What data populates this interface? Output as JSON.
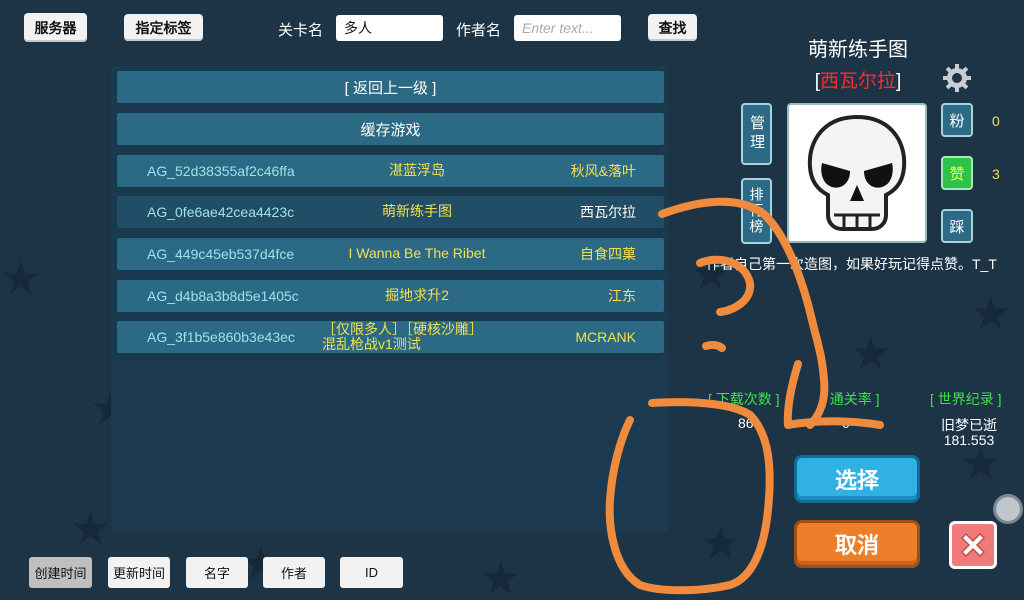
{
  "top_bar": {
    "server_label": "服务器",
    "tag_label": "指定标签",
    "level_name_label": "关卡名",
    "level_name_value": "多人",
    "author_label": "作者名",
    "author_placeholder": "Enter text...",
    "search_label": "查找"
  },
  "list": {
    "back_label": "[ 返回上一级 ]",
    "cache_label": "缓存游戏",
    "rows": [
      {
        "id": "AG_52d38355af2c46ffa",
        "name": "湛蓝浮岛",
        "author": "秋风&落叶"
      },
      {
        "id": "AG_0fe6ae42cea4423c",
        "name": "萌新练手图",
        "author": "西瓦尔拉"
      },
      {
        "id": "AG_449c45eb537d4fce",
        "name": "I Wanna Be The Ribet",
        "author": "自食四菓"
      },
      {
        "id": "AG_d4b8a3b8d5e1405c",
        "name": "掘地求升2",
        "author": "江东"
      },
      {
        "id": "AG_3f1b5e860b3e43ec",
        "name": "［仅限多人］［硬核沙雕］混乱枪战v1测试",
        "author": "MCRANK"
      }
    ]
  },
  "detail": {
    "title": "萌新练手图",
    "author_open": "[",
    "author": "西瓦尔拉",
    "author_close": "]",
    "manage_label": "管理",
    "rank_label": "排行榜",
    "fans_label": "粉",
    "fans_count": "0",
    "like_label": "赞",
    "like_count": "3",
    "dislike_label": "踩",
    "description": "作者自己第一次造图，如果好玩记得点赞。T_T",
    "stats": {
      "downloads_label": "[ 下载次数 ]",
      "downloads_value": "86",
      "pass_rate_label": "[ 通关率 ]",
      "pass_rate_value": "0",
      "record_label": "[ 世界纪录 ]",
      "record_holder": "旧梦已逝",
      "record_time": "181.553"
    },
    "select_label": "选择",
    "cancel_label": "取消"
  },
  "sort_bar": {
    "items": [
      "创建时间",
      "更新时间",
      "名字",
      "作者",
      "ID"
    ],
    "active": "创建时间"
  },
  "colors": {
    "background": "#1c3445",
    "row": "#2b6985",
    "accent_yellow": "#f4e14a",
    "accent_green": "#3fe04f",
    "author_red": "#ff2a2a",
    "scribble_orange": "#f08a3c"
  },
  "icons": [
    "gear-icon",
    "skull-icon",
    "close-icon",
    "star-icon"
  ]
}
